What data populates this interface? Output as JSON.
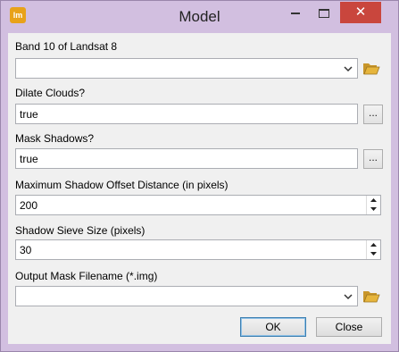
{
  "window": {
    "title": "Model",
    "app_icon_text": "lm",
    "controls": {
      "close_glyph": "✕"
    }
  },
  "fields": {
    "band10": {
      "label": "Band 10 of Landsat 8",
      "value": ""
    },
    "dilate_clouds": {
      "label": "Dilate Clouds?",
      "value": "true",
      "browse_label": "..."
    },
    "mask_shadows": {
      "label": "Mask Shadows?",
      "value": "true",
      "browse_label": "..."
    },
    "max_shadow_offset": {
      "label": "Maximum Shadow Offset Distance (in pixels)",
      "value": "200"
    },
    "shadow_sieve": {
      "label": "Shadow Sieve Size (pixels)",
      "value": "30"
    },
    "output_mask": {
      "label": "Output Mask Filename (*.img)",
      "value": ""
    }
  },
  "buttons": {
    "ok": "OK",
    "cancel": "Close"
  },
  "colors": {
    "titlebar": "#d2bfe0",
    "close": "#c9463d",
    "folder": "#e6b53c",
    "ok_border": "#3c7fb1"
  }
}
